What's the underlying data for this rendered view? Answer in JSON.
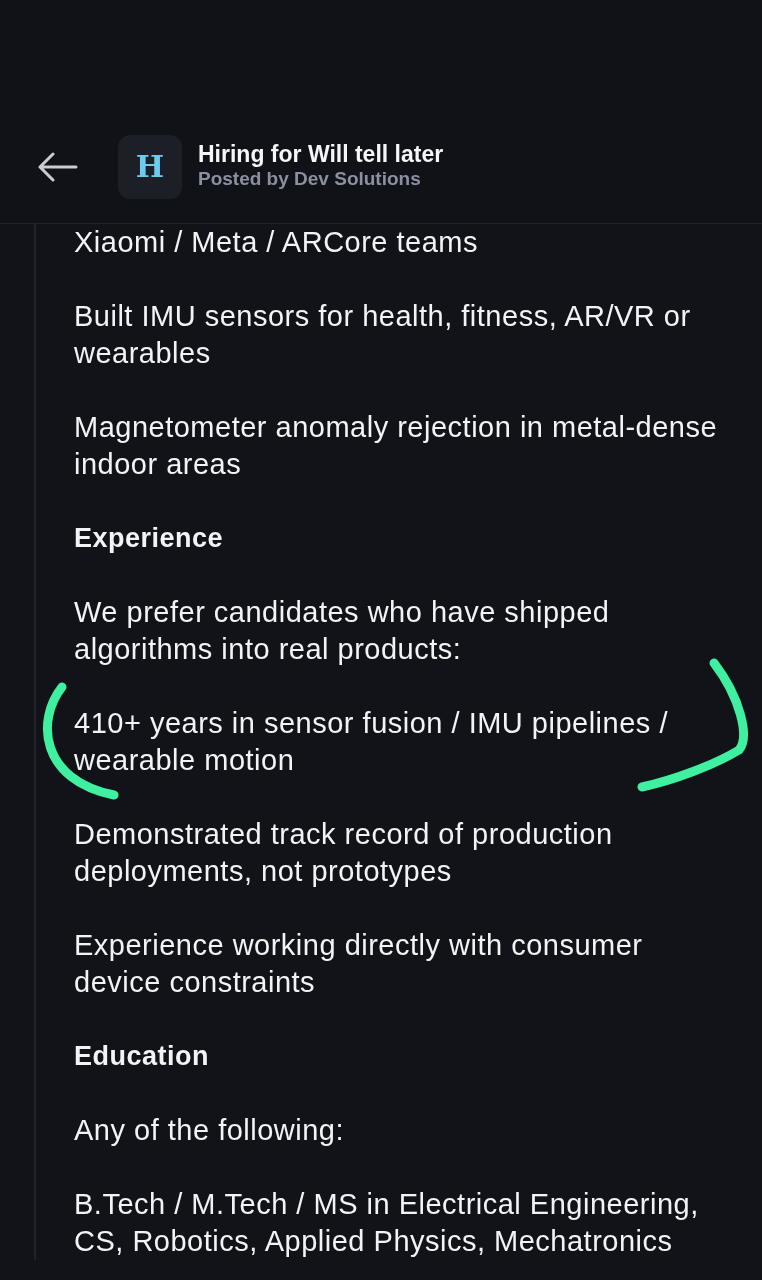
{
  "header": {
    "avatar_letter": "H",
    "title": "Hiring for Will tell later",
    "subtitle": "Posted by Dev Solutions"
  },
  "blocks": [
    {
      "kind": "paragraph",
      "text": "Xiaomi / Meta / ARCore teams",
      "annotated": false
    },
    {
      "kind": "paragraph",
      "text": "Built IMU sensors for health, fitness, AR/VR or wearables",
      "annotated": false
    },
    {
      "kind": "paragraph",
      "text": "Magnetometer anomaly rejection in metal-dense indoor areas",
      "annotated": false
    },
    {
      "kind": "heading",
      "text": "Experience",
      "annotated": false
    },
    {
      "kind": "paragraph",
      "text": "We prefer candidates who have shipped algorithms into real products:",
      "annotated": false
    },
    {
      "kind": "paragraph",
      "text": "410+ years in sensor fusion / IMU pipelines / wearable motion",
      "annotated": true
    },
    {
      "kind": "paragraph",
      "text": "Demonstrated track record of production deployments, not prototypes",
      "annotated": false
    },
    {
      "kind": "paragraph",
      "text": "Experience working directly with consumer device constraints",
      "annotated": false
    },
    {
      "kind": "heading",
      "text": "Education",
      "annotated": false
    },
    {
      "kind": "paragraph",
      "text": "Any of the following:",
      "annotated": false
    },
    {
      "kind": "paragraph",
      "text": "B.Tech / M.Tech / MS in Electrical Engineering, CS, Robotics, Applied Physics, Mechatronics",
      "annotated": false
    }
  ]
}
